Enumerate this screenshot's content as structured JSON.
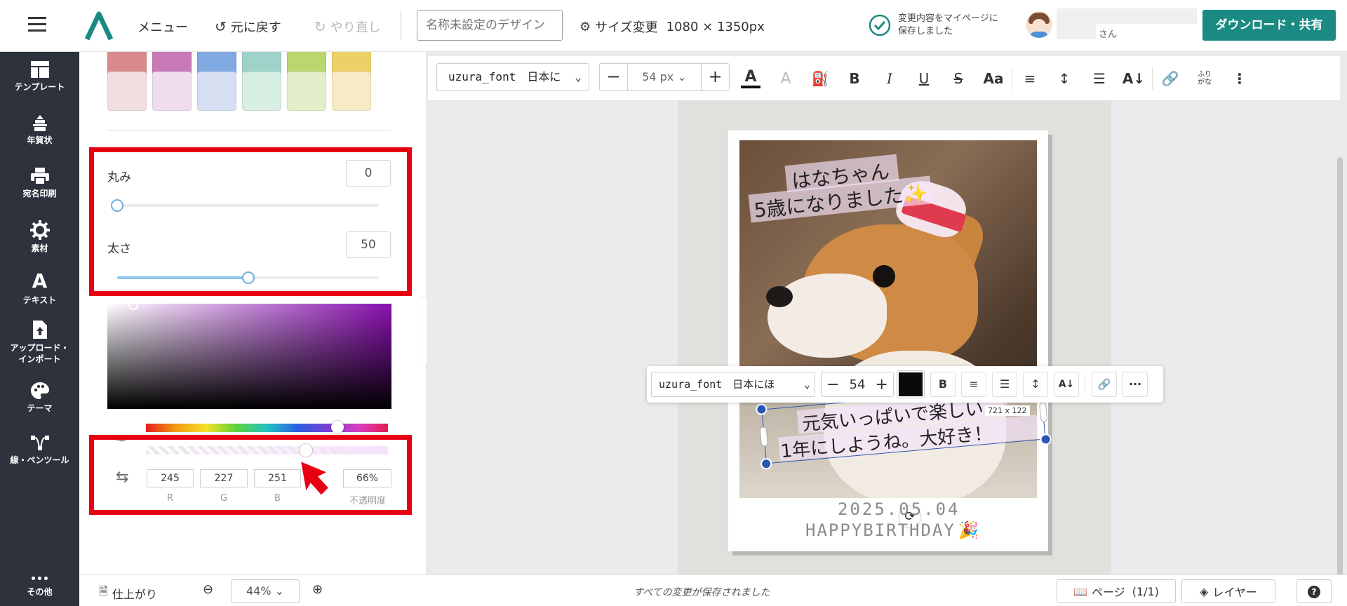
{
  "header": {
    "menu_label": "メニュー",
    "undo_label": "元に戻す",
    "redo_label": "やり直し",
    "design_name_placeholder": "名称未設定のデザイン",
    "resize_label": "サイズ変更",
    "canvas_size": "1080 × 1350px",
    "save_status_line1": "変更内容をマイページに",
    "save_status_line2": "保存しました",
    "user_suffix": "さん",
    "download_label": "ダウンロード・共有"
  },
  "sidebar": {
    "items": [
      {
        "label": "テンプレート",
        "icon": "template-icon"
      },
      {
        "label": "年賀状",
        "icon": "new-year-card-icon"
      },
      {
        "label": "宛名印刷",
        "icon": "printer-icon"
      },
      {
        "label": "素材",
        "icon": "material-icon"
      },
      {
        "label": "テキスト",
        "icon": "text-icon"
      },
      {
        "label": "アップロード・",
        "label2": "インポート",
        "icon": "upload-icon"
      },
      {
        "label": "テーマ",
        "icon": "palette-icon"
      },
      {
        "label": "線・ペンツール",
        "icon": "pen-tool-icon"
      }
    ],
    "more_label": "その他"
  },
  "panel": {
    "swatches_row1": [
      "#d98a8c",
      "#c979b8",
      "#7fa9e0",
      "#9fd2c8",
      "#b9d66f",
      "#ecd068"
    ],
    "swatches_row2": [
      "#f2dde0",
      "#efdcec",
      "#d6def2",
      "#d8eee2",
      "#e2eec9",
      "#f7ebc6"
    ],
    "roundness_label": "丸み",
    "roundness_value": "0",
    "thickness_label": "太さ",
    "thickness_value": "50",
    "thickness_fraction": 0.5,
    "hue_fraction": 0.79,
    "alpha_fraction": 0.66,
    "rgb": {
      "r": "245",
      "g": "227",
      "b": "251",
      "a": "66%"
    },
    "rgb_labels": {
      "r": "R",
      "g": "G",
      "b": "B",
      "a": "不透明度"
    }
  },
  "toolbar": {
    "font_name": "uzura_font　日本に",
    "font_size": "54 px"
  },
  "floating_toolbar": {
    "font_name": "uzura_font　日本にほ",
    "font_size": "54",
    "color": "#0a0a0a"
  },
  "card": {
    "title_line1": "はなちゃん",
    "title_line2": "5歳になりました✨",
    "message_line1": "元気いっぱいで楽しい",
    "message_line2": "1年にしようね。大好き！",
    "size_badge": "721 x 122",
    "date_text": "2025.05.04",
    "birthday_text": "HAPPYBIRTHDAY"
  },
  "footer": {
    "finish_label": "仕上がり",
    "zoom_value": "44%",
    "save_status": "すべての変更が保存されました",
    "page_label": "ページ",
    "page_count": "(1/1)",
    "layer_label": "レイヤー"
  },
  "colors": {
    "brand": "#1a8a82",
    "sidebar_bg": "#2e323c",
    "highlight_red": "#e60012",
    "selection_blue": "#2a55b5"
  }
}
